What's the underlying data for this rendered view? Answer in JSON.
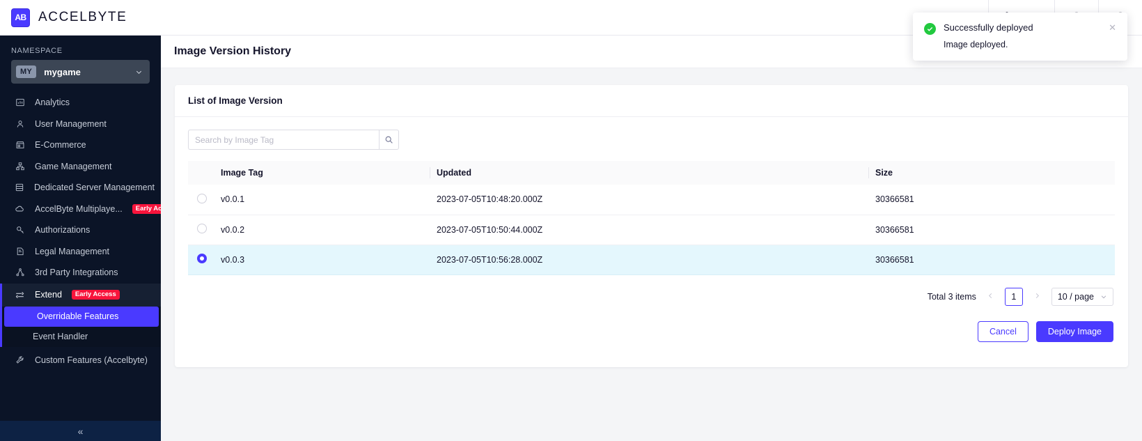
{
  "topbar": {
    "brand_initials": "AB",
    "brand_name": "ACCELBYTE",
    "platform_label": "Platfo"
  },
  "sidebar": {
    "namespace_label": "NAMESPACE",
    "namespace_badge": "MY",
    "namespace_value": "mygame",
    "items": [
      {
        "label": "Analytics",
        "icon": "bar-chart-icon"
      },
      {
        "label": "User Management",
        "icon": "user-icon"
      },
      {
        "label": "E-Commerce",
        "icon": "store-icon"
      },
      {
        "label": "Game Management",
        "icon": "sitemap-icon"
      },
      {
        "label": "Dedicated Server Management",
        "icon": "server-icon"
      },
      {
        "label": "AccelByte Multiplaye...",
        "icon": "cloud-icon",
        "badge": "Early Access"
      },
      {
        "label": "Authorizations",
        "icon": "key-icon"
      },
      {
        "label": "Legal Management",
        "icon": "document-icon"
      },
      {
        "label": "3rd Party Integrations",
        "icon": "share-icon"
      }
    ],
    "extend": {
      "label": "Extend",
      "icon": "sliders-icon",
      "badge": "Early Access",
      "children": [
        {
          "label": "Overridable Features",
          "selected": true
        },
        {
          "label": "Event Handler",
          "selected": false
        }
      ]
    },
    "custom_features": {
      "label": "Custom Features (Accelbyte)",
      "icon": "wrench-icon"
    },
    "collapse_glyph": "«"
  },
  "page": {
    "title": "Image Version History"
  },
  "card": {
    "title": "List of Image Version",
    "search_placeholder": "Search by Image Tag",
    "search_value": "",
    "columns": [
      "Image Tag",
      "Updated",
      "Size"
    ],
    "rows": [
      {
        "selected": false,
        "tag": "v0.0.1",
        "updated": "2023-07-05T10:48:20.000Z",
        "size": "30366581"
      },
      {
        "selected": false,
        "tag": "v0.0.2",
        "updated": "2023-07-05T10:50:44.000Z",
        "size": "30366581"
      },
      {
        "selected": true,
        "tag": "v0.0.3",
        "updated": "2023-07-05T10:56:28.000Z",
        "size": "30366581"
      }
    ],
    "pagination": {
      "total_text": "Total 3 items",
      "current_page": "1",
      "page_size": "10 / page"
    },
    "cancel_label": "Cancel",
    "deploy_label": "Deploy Image"
  },
  "toast": {
    "title": "Successfully deployed",
    "description": "Image deployed.",
    "close_glyph": "✕"
  },
  "colors": {
    "accent": "#4a3aff",
    "sidebar_bg": "#0b1427",
    "badge_red": "#f8143c",
    "success_green": "#22c93f",
    "selected_row": "#e4f7fd"
  }
}
